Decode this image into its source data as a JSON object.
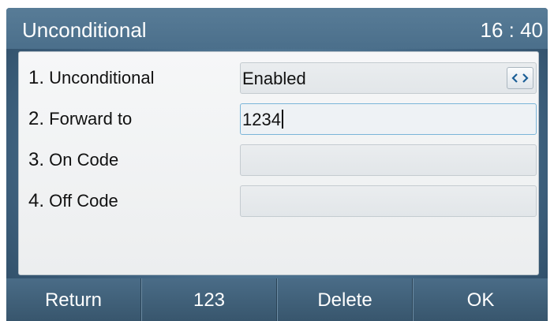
{
  "header": {
    "title": "Unconditional",
    "time": "16 : 40"
  },
  "rows": [
    {
      "number": "1.",
      "label": "Unconditional",
      "value": "Enabled",
      "control": "switch-icon"
    },
    {
      "number": "2.",
      "label": "Forward to",
      "value": "1234"
    },
    {
      "number": "3.",
      "label": "On Code",
      "value": ""
    },
    {
      "number": "4.",
      "label": "Off Code",
      "value": ""
    }
  ],
  "softkeys": [
    "Return",
    "123",
    "Delete",
    "OK"
  ],
  "colors": {
    "titlebar": "#4f7390",
    "panel": "#f2f3f4",
    "focus_border": "#7bb5d8",
    "switch_arrows": "#1c5f96"
  }
}
